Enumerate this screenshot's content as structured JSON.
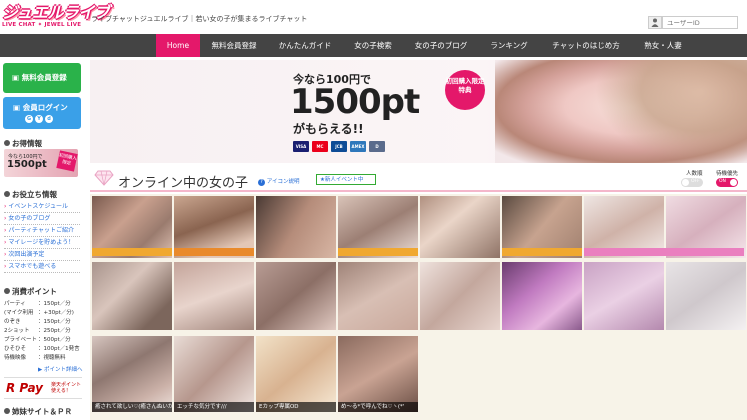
{
  "header": {
    "logo_main": "ジュエルライブ",
    "logo_sub": "LIVE CHAT ✦ JEWEL LIVE",
    "tagline": "ライブチャットジュエルライブ｜若い女の子が集まるライブチャット",
    "user_id_placeholder": "ユーザーID"
  },
  "nav": {
    "items": [
      {
        "label": "Home",
        "active": true
      },
      {
        "label": "無料会員登録"
      },
      {
        "label": "かんたんガイド"
      },
      {
        "label": "女の子検索"
      },
      {
        "label": "女の子のブログ"
      },
      {
        "label": "ランキング"
      },
      {
        "label": "チャットのはじめ方"
      },
      {
        "label": "熟女・人妻"
      }
    ]
  },
  "sidebar": {
    "register_label": "無料会員登録",
    "login_label": "会員ログイン",
    "login_badges": [
      "G",
      "Y",
      "d"
    ],
    "deals_heading": "お得情報",
    "deal_banner": {
      "line1": "今なら100円で",
      "line2": "1500pt",
      "badge": "初回購入限定"
    },
    "useful_heading": "お役立ち情報",
    "useful_links": [
      "イベントスケジュール",
      "女の子のブログ",
      "パーティチャットご紹介",
      "マイレージを貯めよう！",
      "次回出演予定",
      "スマホでも遊べる"
    ],
    "points_heading": "消費ポイント",
    "prices": [
      {
        "k": "パーティ",
        "v": "：150pt／分"
      },
      {
        "k": "(マイク利用",
        "v": "：+30pt／分)"
      },
      {
        "k": "のぞき",
        "v": "：150pt／分"
      },
      {
        "k": "2ショット",
        "v": "：250pt／分"
      },
      {
        "k": "プライベート",
        "v": "：500pt／分"
      },
      {
        "k": "ひそひそ",
        "v": "：100pt／1発言"
      },
      {
        "k": "待機映像",
        "v": "：視聴無料"
      }
    ],
    "price_more": "▶ ポイント詳細へ",
    "rpay_logo": "R Pay",
    "rpay_note_1": "楽天ポイント",
    "rpay_note_2": "使える！",
    "sister_heading": "姉妹サイト＆ＰＲ"
  },
  "banner": {
    "line1": "今なら100円で",
    "line2": "1500pt",
    "line3": "がもらえる!!",
    "burst": "初回購入限定特典",
    "cards": [
      {
        "label": "VISA",
        "color": "#1a1f71"
      },
      {
        "label": "MC",
        "color": "#eb001b"
      },
      {
        "label": "JCB",
        "color": "#0e4c96"
      },
      {
        "label": "AMEX",
        "color": "#2e77bb"
      },
      {
        "label": "D",
        "color": "#5a6b8c"
      }
    ]
  },
  "online": {
    "title": "オンライン中の女の子",
    "help": "アイコン説明",
    "event": "★新人イベント中",
    "filters": [
      {
        "label": "人数順",
        "state": "OFF"
      },
      {
        "label": "待機優先",
        "state": "ON"
      }
    ],
    "captions": [
      "癒されて欲しい♡(癒さんぬいか",
      "エッチな気分です///",
      "Eカップ専属OD",
      "め～る*で呼んでね♡ヽ(*'"
    ]
  }
}
